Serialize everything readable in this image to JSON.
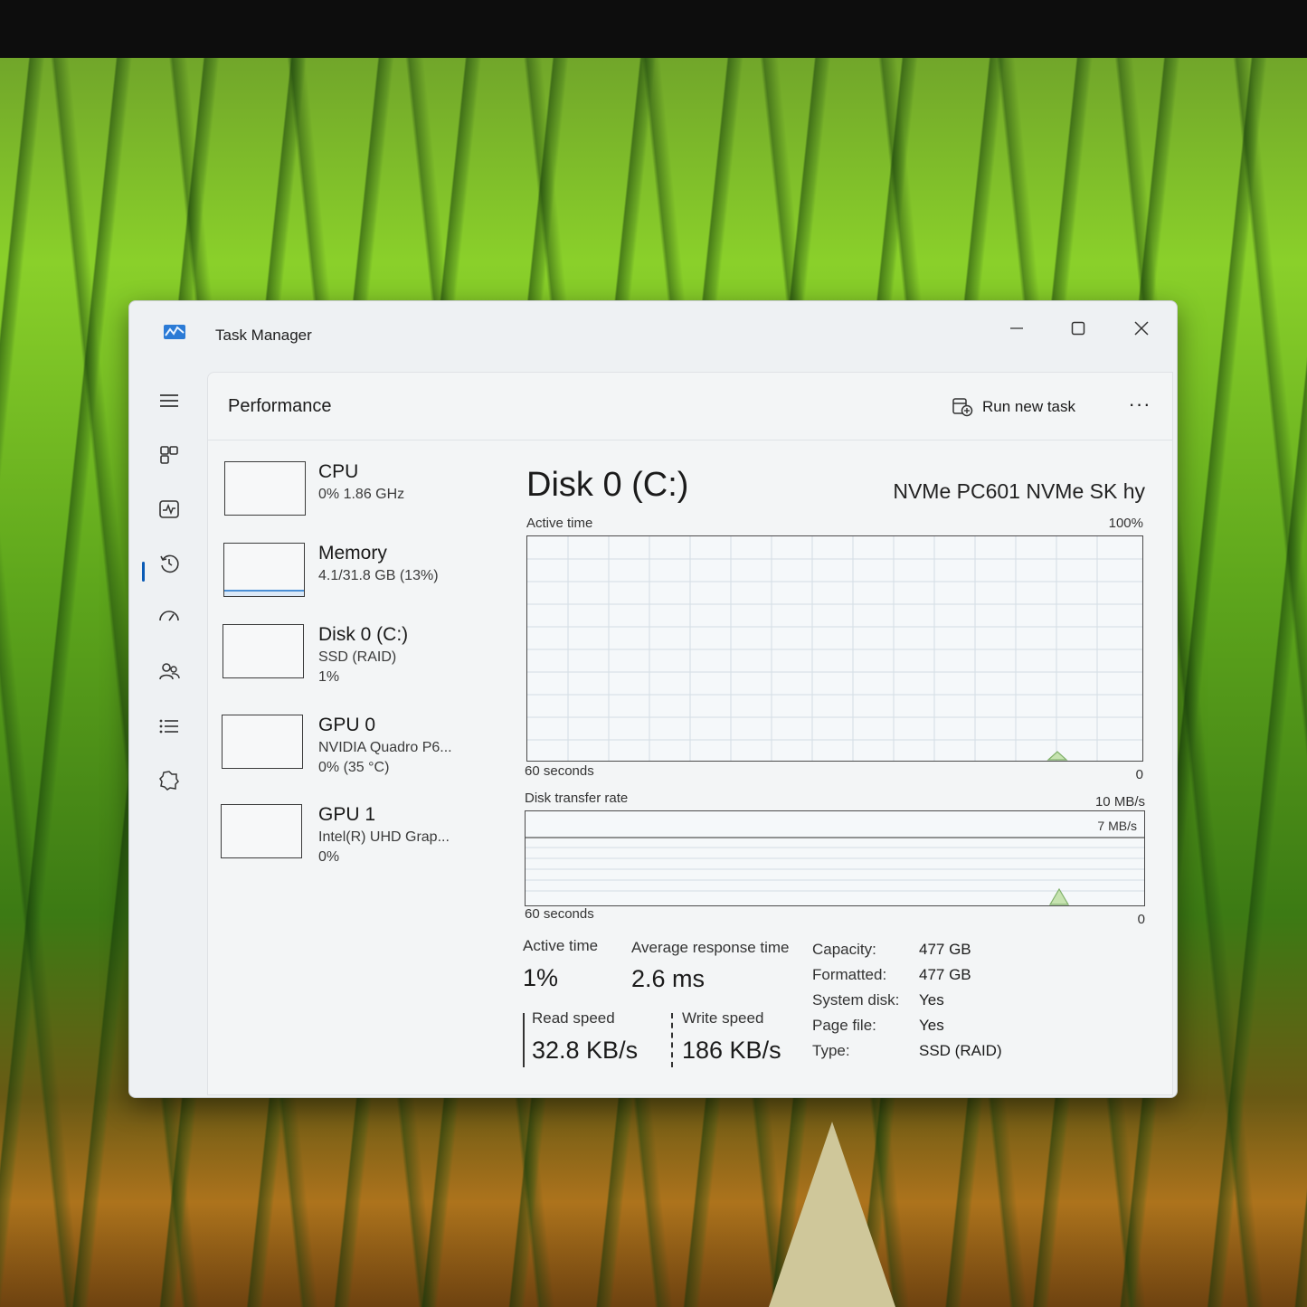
{
  "window": {
    "title": "Task Manager"
  },
  "header": {
    "page_title": "Performance",
    "run_new_task": "Run new task",
    "more": "···"
  },
  "nav": {
    "items": [
      "menu-icon",
      "processes-icon",
      "performance-icon",
      "app-history-icon",
      "startup-apps-icon",
      "users-icon",
      "details-icon",
      "services-icon"
    ],
    "settings": "settings-icon"
  },
  "devices": [
    {
      "name": "CPU",
      "line1": "0% 1.86 GHz",
      "line2": ""
    },
    {
      "name": "Memory",
      "line1": "4.1/31.8 GB (13%)",
      "line2": ""
    },
    {
      "name": "Disk 0 (C:)",
      "line1": "SSD (RAID)",
      "line2": "1%"
    },
    {
      "name": "GPU 0",
      "line1": "NVIDIA Quadro P6...",
      "line2": "0% (35 °C)"
    },
    {
      "name": "GPU 1",
      "line1": "Intel(R) UHD Grap...",
      "line2": "0%"
    }
  ],
  "detail": {
    "title": "Disk 0 (C:)",
    "model": "NVMe PC601 NVMe SK hy",
    "active_time_graph": {
      "label": "Active time",
      "max": "100%",
      "span": "60 seconds",
      "min": "0"
    },
    "transfer_graph": {
      "label": "Disk transfer rate",
      "max": "10 MB/s",
      "marker": "7 MB/s",
      "span": "60 seconds",
      "min": "0"
    },
    "stats": {
      "active_time_label": "Active time",
      "active_time": "1%",
      "avg_response_label": "Average response time",
      "avg_response": "2.6 ms",
      "read_label": "Read speed",
      "read": "32.8 KB/s",
      "write_label": "Write speed",
      "write": "186 KB/s"
    },
    "properties": [
      {
        "k": "Capacity:",
        "v": "477 GB"
      },
      {
        "k": "Formatted:",
        "v": "477 GB"
      },
      {
        "k": "System disk:",
        "v": "Yes"
      },
      {
        "k": "Page file:",
        "v": "Yes"
      },
      {
        "k": "Type:",
        "v": "SSD (RAID)"
      }
    ]
  },
  "colors": {
    "accent": "#0a5bb5",
    "graph_line": "#7fb069",
    "memory_line": "#4a8fd6"
  }
}
